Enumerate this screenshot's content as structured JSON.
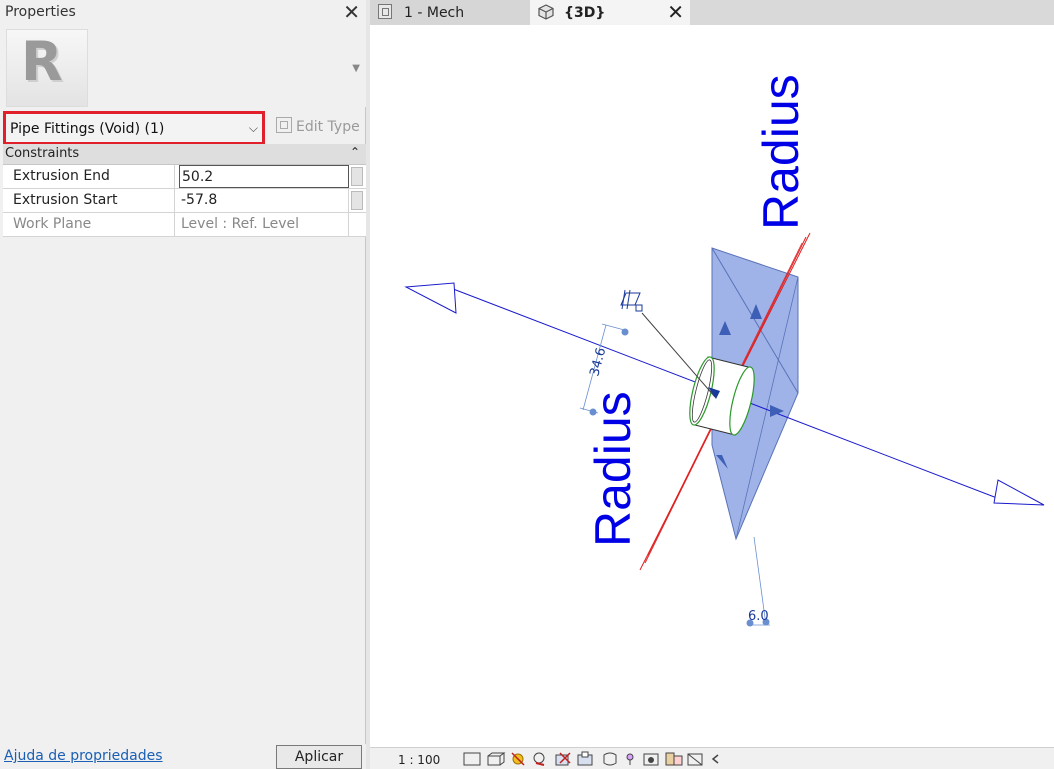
{
  "properties_panel": {
    "title": "Properties",
    "close_glyph": "✕",
    "type_logo_letter": "R",
    "type_selector": {
      "value": "Pipe Fittings (Void) (1)"
    },
    "edit_type_label": "Edit Type",
    "group": {
      "label": "Constraints",
      "collapse_glyph": "⌃"
    },
    "rows": [
      {
        "name": "Extrusion End",
        "value": "50.2"
      },
      {
        "name": "Extrusion Start",
        "value": "-57.8"
      },
      {
        "name": "Work Plane",
        "value": "Level : Ref. Level"
      }
    ],
    "help_link": "Ajuda de propriedades",
    "apply_label": "Aplicar"
  },
  "tabs": [
    {
      "label": "1 - Mech",
      "active": false,
      "icon": "floor-plan-icon"
    },
    {
      "label": "{3D}",
      "active": true,
      "icon": "3d-view-icon"
    }
  ],
  "viewport": {
    "labels": {
      "radius_top": "Radius",
      "radius_left": "Radius",
      "dim_left": "34.6",
      "dim_bottom": "6.0"
    },
    "colors": {
      "axis_blue": "#1a1acc",
      "plane_fill": "#7f9be0",
      "red_ref": "#e02020",
      "green_ref": "#2a9a2a",
      "radius_text": "#0000e6"
    }
  },
  "statusbar": {
    "scale": "1 : 100",
    "icons": [
      "detail-level-icon",
      "visual-style-icon",
      "sun-path-icon",
      "shadows-icon",
      "crop-view-icon",
      "show-crop-icon",
      "unlock-3d-icon",
      "temporary-hide-icon",
      "reveal-elements-icon",
      "worksharing-icon",
      "analytical-model-icon",
      "constraints-icon",
      "collapse-arrow-icon"
    ]
  }
}
